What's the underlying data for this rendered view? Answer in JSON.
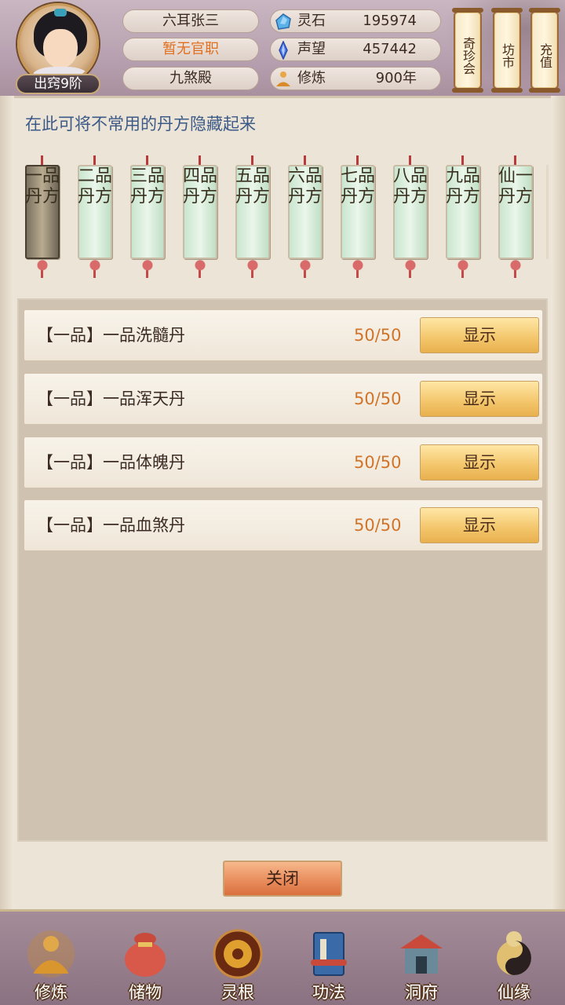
{
  "header": {
    "rank_badge": "出窍9阶",
    "player_name": "六耳张三",
    "official_title": "暂无官职",
    "palace": "九煞殿",
    "stats": [
      {
        "label": "灵石",
        "value": "195974",
        "icon": "spirit-stone-icon"
      },
      {
        "label": "声望",
        "value": "457442",
        "icon": "reputation-crystal-icon"
      },
      {
        "label": "修炼",
        "value": "900年",
        "icon": "meditation-icon"
      }
    ],
    "shortcuts": [
      "奇珍会",
      "坊市",
      "充值"
    ]
  },
  "panel": {
    "hint": "在此可将不常用的丹方隐藏起来",
    "tabs": [
      "一品丹方",
      "二品丹方",
      "三品丹方",
      "四品丹方",
      "五品丹方",
      "六品丹方",
      "七品丹方",
      "八品丹方",
      "九品丹方",
      "仙一丹方"
    ],
    "active_tab": 0,
    "recipes": [
      {
        "name": "【一品】一品洗髓丹",
        "count": "50/50",
        "action": "显示"
      },
      {
        "name": "【一品】一品浑天丹",
        "count": "50/50",
        "action": "显示"
      },
      {
        "name": "【一品】一品体魄丹",
        "count": "50/50",
        "action": "显示"
      },
      {
        "name": "【一品】一品血煞丹",
        "count": "50/50",
        "action": "显示"
      }
    ],
    "close_label": "关闭"
  },
  "bottom_nav": [
    {
      "label": "修炼",
      "icon": "cultivation-icon",
      "color": "#d9a040"
    },
    {
      "label": "储物",
      "icon": "storage-bag-icon",
      "color": "#d85a4a"
    },
    {
      "label": "灵根",
      "icon": "spirit-root-icon",
      "color": "#8a3a1a"
    },
    {
      "label": "功法",
      "icon": "technique-book-icon",
      "color": "#3a6aa8"
    },
    {
      "label": "洞府",
      "icon": "cave-abode-icon",
      "color": "#5a8a9a"
    },
    {
      "label": "仙缘",
      "icon": "immortal-fate-icon",
      "color": "#e0c070"
    }
  ],
  "colors": {
    "accent_title": "#e07020",
    "hint_text": "#3c5a88",
    "count_text": "#d0742a"
  }
}
